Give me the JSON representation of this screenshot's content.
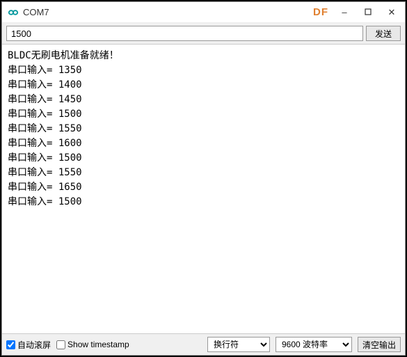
{
  "titlebar": {
    "title": "COM7",
    "watermark": "DF",
    "minimize": "–",
    "maximize": "❐",
    "close": "✕"
  },
  "input": {
    "value": "1500",
    "send_label": "发送"
  },
  "output": {
    "header": "BLDC无刷电机准备就绪！",
    "prefix": "串口输入= ",
    "values": [
      "1350",
      "1400",
      "1450",
      "1500",
      "1550",
      "1600",
      "1500",
      "1550",
      "1650",
      "1500"
    ]
  },
  "footer": {
    "autoscroll_label": "自动滚屏",
    "timestamp_label": "Show timestamp",
    "line_ending": "换行符",
    "baud_rate": "9600 波特率",
    "clear_label": "清空输出"
  }
}
